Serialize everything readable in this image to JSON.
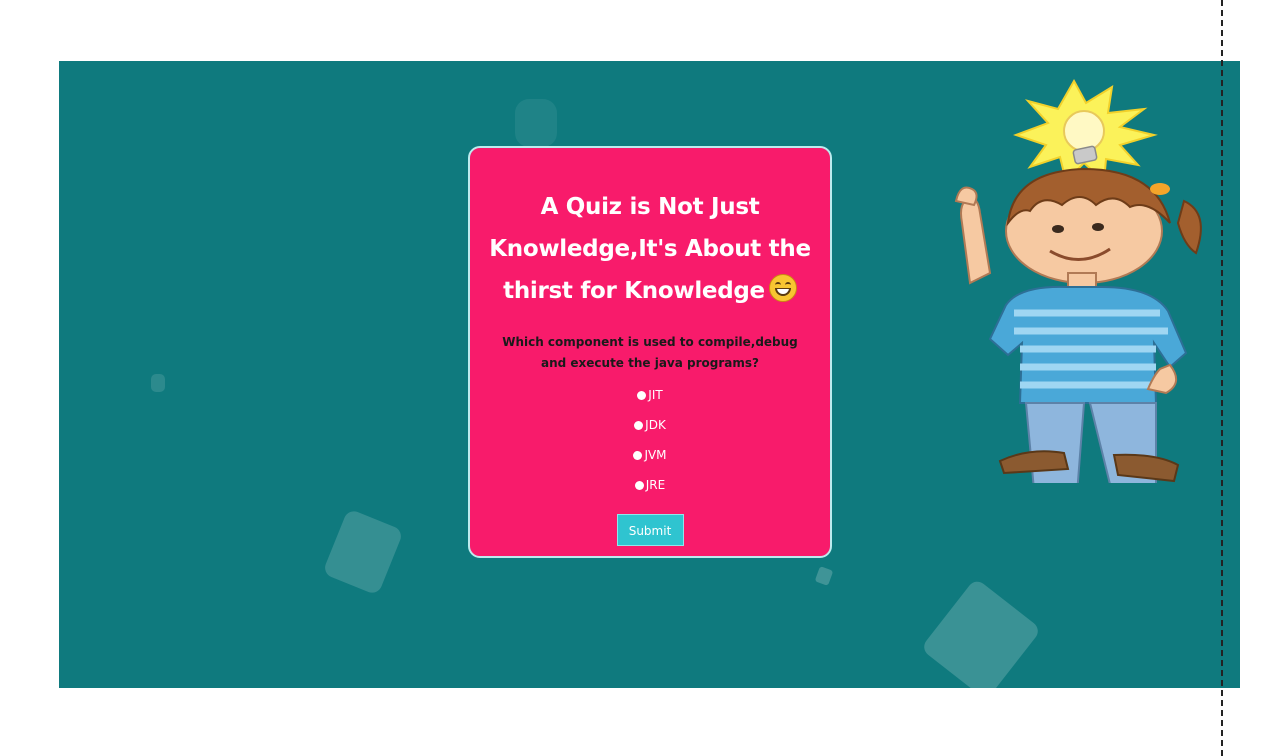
{
  "quiz": {
    "title": "A Quiz is Not Just Knowledge,It's About the thirst for Knowledge",
    "title_emoji_icon": "grinning-face-icon",
    "question": "Which component is used to compile,debug and execute the java programs?",
    "options": [
      {
        "label": "JIT"
      },
      {
        "label": "JDK"
      },
      {
        "label": "JVM"
      },
      {
        "label": "JRE"
      }
    ],
    "submit_label": "Submit"
  },
  "illustration": {
    "icon": "girl-with-lightbulb-illustration"
  },
  "colors": {
    "stage_background": "#0f7a7e",
    "card_background": "#f81b6b",
    "submit_button": "#2fc4d0"
  }
}
